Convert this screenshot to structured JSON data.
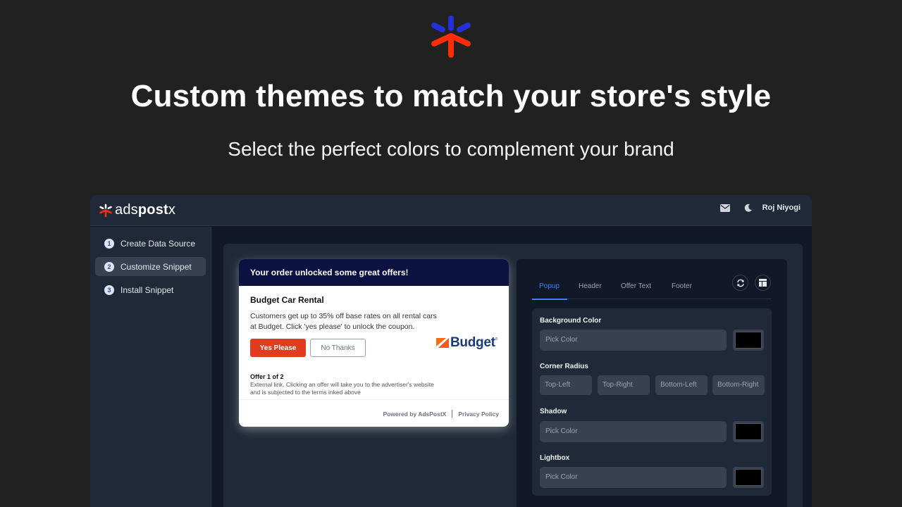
{
  "hero": {
    "title": "Custom themes to match your store's style",
    "subtitle": "Select the perfect colors to complement your brand",
    "logo_icon": "adspostx-asterisk-icon"
  },
  "app": {
    "brand": {
      "prefix": "ads",
      "bold": "post",
      "suffix": "x"
    },
    "topbar": {
      "mail_icon": "mail-icon",
      "theme_icon": "moon-icon",
      "user_name": "Roj Niyogi"
    },
    "sidebar": {
      "steps": [
        {
          "num": "1",
          "label": "Create Data Source",
          "active": false
        },
        {
          "num": "2",
          "label": "Customize Snippet",
          "active": true
        },
        {
          "num": "3",
          "label": "Install Snippet",
          "active": false
        }
      ]
    },
    "preview": {
      "header": "Your order unlocked some great offers!",
      "offer_title": "Budget Car Rental",
      "offer_text": "Customers get up to 35% off base rates on all rental cars at Budget. Click 'yes please' to unlock the coupon.",
      "yes_label": "Yes Please",
      "no_label": "No Thanks",
      "advertiser_logo": "Budget",
      "advertiser_reg": "®",
      "offer_count": "Offer 1 of 2",
      "disclaimer": "External link. Clicking an offer will take you to the advertiser's website and is subjected to the terms inked above",
      "powered_by": "Powered by AdsPostX",
      "privacy": "Privacy Policy",
      "colors": {
        "header_bg": "#0b1140",
        "yes_button": "#e23b1f"
      }
    },
    "settings": {
      "tabs": [
        {
          "label": "Popup",
          "active": true
        },
        {
          "label": "Header",
          "active": false
        },
        {
          "label": "Offer Text",
          "active": false
        },
        {
          "label": "Footer",
          "active": false
        }
      ],
      "actions": {
        "reset_icon": "refresh-icon",
        "layout_icon": "layout-icon"
      },
      "fields": {
        "background_color": {
          "label": "Background Color",
          "placeholder": "Pick Color",
          "swatch": "#000000"
        },
        "corner_radius": {
          "label": "Corner Radius",
          "placeholders": [
            "Top-Left",
            "Top-Right",
            "Bottom-Left",
            "Bottom-Right"
          ]
        },
        "shadow": {
          "label": "Shadow",
          "placeholder": "Pick Color",
          "swatch": "#000000"
        },
        "lightbox": {
          "label": "Lightbox",
          "placeholder": "Pick Color",
          "swatch": "#000000"
        }
      },
      "accent": "#3b82f6"
    }
  }
}
